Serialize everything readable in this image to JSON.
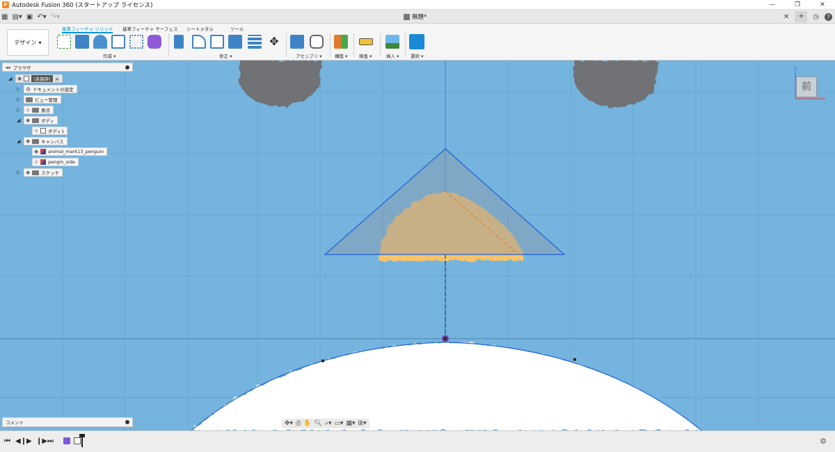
{
  "window": {
    "title": "Autodesk Fusion 360 (スタートアップ ライセンス)",
    "minimize": "—",
    "restore": "❐",
    "close": "✕"
  },
  "document": {
    "tab_title": "無題*"
  },
  "ribbon": {
    "workspace": "デザイン",
    "tabs": [
      "基準フィーチャ ソリッド",
      "基準フィーチャ サーフェス",
      "シートメタル",
      "ツール"
    ],
    "active_tab": 0,
    "groups": [
      "作成",
      "修正",
      "アセンブリ",
      "構築",
      "検査",
      "挿入",
      "選択"
    ]
  },
  "browser": {
    "title": "ブラウザ",
    "root": "(未保存)",
    "nodes": [
      {
        "label": "ドキュメントの設定"
      },
      {
        "label": "ビュー管理"
      },
      {
        "label": "原点"
      },
      {
        "label": "ボディ"
      },
      {
        "label": "ボディ1"
      },
      {
        "label": "キャンバス"
      },
      {
        "label": "animal_mark13_penguin"
      },
      {
        "label": "pengin_side"
      },
      {
        "label": "スケッチ"
      }
    ]
  },
  "comments": {
    "title": "コメント"
  },
  "viewcube": {
    "face": "前",
    "axis": "Z"
  },
  "colors": {
    "viewport_bg": "#74b4de",
    "sketch_line": "#1f5fd8",
    "beak": "#f7c46a",
    "eye": "#6f7276",
    "accent": "#0696d7"
  },
  "icons": {
    "grid": "grid-icon",
    "file": "file-icon",
    "save": "save-icon",
    "undo": "undo-icon",
    "redo": "redo-icon",
    "help": "help-icon",
    "settings": "gear-icon"
  }
}
